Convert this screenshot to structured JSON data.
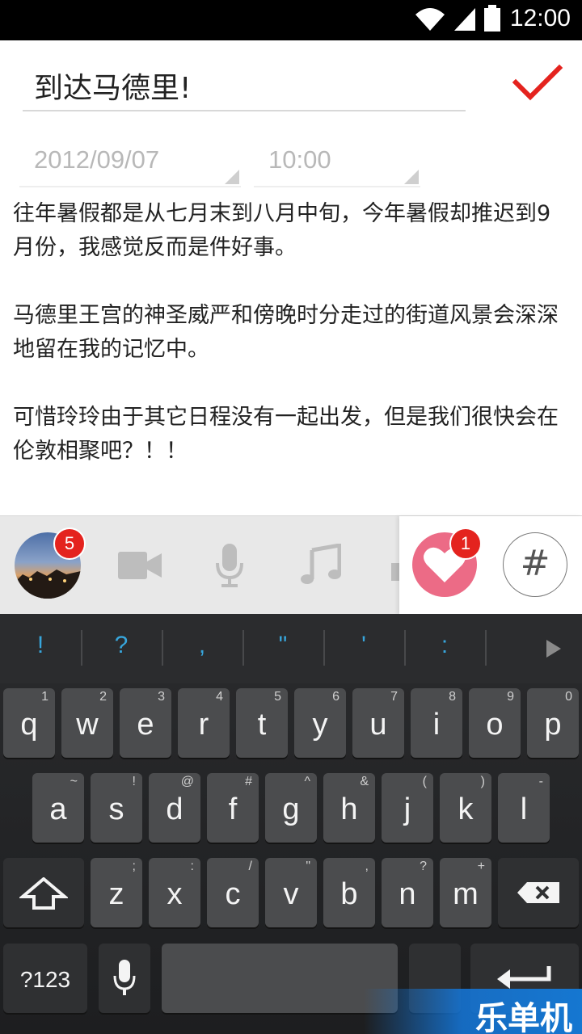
{
  "status_bar": {
    "time": "12:00",
    "icons": [
      "wifi-icon",
      "signal-icon",
      "battery-icon"
    ]
  },
  "title": {
    "value": "到达马德里!"
  },
  "date_field": {
    "value": "2012/09/07"
  },
  "time_field": {
    "value": "10:00"
  },
  "body": {
    "paragraphs": [
      "往年暑假都是从七月末到八月中旬，今年暑假却推迟到9月份，我感觉反而是件好事。",
      "马德里王宫的神圣威严和傍晚时分走过的街道风景会深深地留在我的记忆中。",
      "可惜玲玲由于其它日程没有一起出发，但是我们很快会在伦敦相聚吧？！！"
    ]
  },
  "toolbar": {
    "photo_count": "5",
    "like_count": "1",
    "hash_label": "#",
    "icons": [
      "video-icon",
      "microphone-icon",
      "music-icon",
      "heart-icon"
    ]
  },
  "keyboard": {
    "suggestions": [
      "!",
      "?",
      ",",
      "\"",
      "'",
      ":"
    ],
    "row1": [
      {
        "k": "q",
        "h": "1"
      },
      {
        "k": "w",
        "h": "2"
      },
      {
        "k": "e",
        "h": "3"
      },
      {
        "k": "r",
        "h": "4"
      },
      {
        "k": "t",
        "h": "5"
      },
      {
        "k": "y",
        "h": "6"
      },
      {
        "k": "u",
        "h": "7"
      },
      {
        "k": "i",
        "h": "8"
      },
      {
        "k": "o",
        "h": "9"
      },
      {
        "k": "p",
        "h": "0"
      }
    ],
    "row2": [
      {
        "k": "a",
        "h": "~"
      },
      {
        "k": "s",
        "h": "!"
      },
      {
        "k": "d",
        "h": "@"
      },
      {
        "k": "f",
        "h": "#"
      },
      {
        "k": "g",
        "h": "^"
      },
      {
        "k": "h",
        "h": "&"
      },
      {
        "k": "j",
        "h": "("
      },
      {
        "k": "k",
        "h": ")"
      },
      {
        "k": "l",
        "h": "-"
      }
    ],
    "row3": [
      {
        "k": "z",
        "h": ";"
      },
      {
        "k": "x",
        "h": ":"
      },
      {
        "k": "c",
        "h": "/"
      },
      {
        "k": "v",
        "h": "\""
      },
      {
        "k": "b",
        "h": ","
      },
      {
        "k": "n",
        "h": "?"
      },
      {
        "k": "m",
        "h": "+"
      }
    ],
    "symbols_label": "?123"
  },
  "watermark": {
    "text": "乐单机"
  },
  "colors": {
    "accent_red": "#e4231e",
    "heart_pink": "#ec6b86",
    "suggestion_blue": "#37a6dc"
  }
}
